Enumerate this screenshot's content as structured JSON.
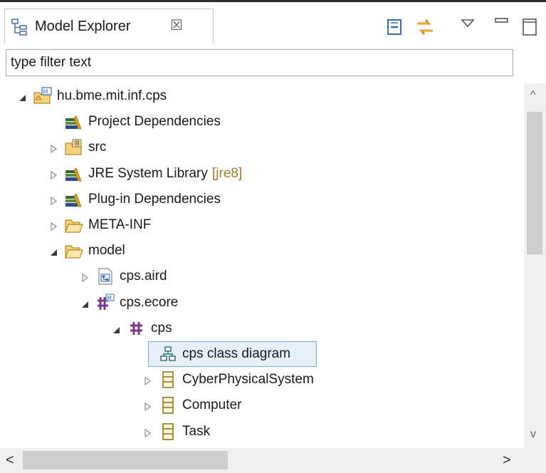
{
  "view": {
    "title": "Model Explorer",
    "close_glyph": "☒",
    "filter_placeholder": "type filter text",
    "toolbar": [
      {
        "name": "collapse-all-icon"
      },
      {
        "name": "link-with-editor-icon"
      },
      {
        "name": "view-menu-icon"
      },
      {
        "name": "minimize-icon"
      },
      {
        "name": "maximize-icon"
      }
    ]
  },
  "tree": [
    {
      "label": "hu.bme.mit.inf.cps",
      "decoration": "",
      "icon": "modeling-project-icon",
      "expanded": true,
      "has_children": true,
      "depth": 0
    },
    {
      "label": "Project Dependencies",
      "decoration": "",
      "icon": "library-icon",
      "expanded": false,
      "has_children": false,
      "depth": 1
    },
    {
      "label": "src",
      "decoration": "",
      "icon": "source-folder-icon",
      "expanded": false,
      "has_children": true,
      "depth": 1
    },
    {
      "label": "JRE System Library",
      "decoration": "[jre8]",
      "icon": "library-icon",
      "expanded": false,
      "has_children": true,
      "depth": 1
    },
    {
      "label": "Plug-in Dependencies",
      "decoration": "",
      "icon": "library-icon",
      "expanded": false,
      "has_children": true,
      "depth": 1
    },
    {
      "label": "META-INF",
      "decoration": "",
      "icon": "folder-icon",
      "expanded": false,
      "has_children": true,
      "depth": 1
    },
    {
      "label": "model",
      "decoration": "",
      "icon": "folder-icon",
      "expanded": true,
      "has_children": true,
      "depth": 1
    },
    {
      "label": "cps.aird",
      "decoration": "",
      "icon": "aird-file-icon",
      "expanded": false,
      "has_children": true,
      "depth": 2
    },
    {
      "label": "cps.ecore",
      "decoration": "",
      "icon": "ecore-file-icon",
      "expanded": true,
      "has_children": true,
      "depth": 2
    },
    {
      "label": "cps",
      "decoration": "",
      "icon": "epackage-icon",
      "expanded": true,
      "has_children": true,
      "depth": 3
    },
    {
      "label": "cps class diagram",
      "decoration": "",
      "icon": "class-diagram-icon",
      "expanded": false,
      "has_children": false,
      "depth": 4,
      "selected": true
    },
    {
      "label": "CyberPhysicalSystem",
      "decoration": "",
      "icon": "eclass-icon",
      "expanded": false,
      "has_children": true,
      "depth": 4
    },
    {
      "label": "Computer",
      "decoration": "",
      "icon": "eclass-icon",
      "expanded": false,
      "has_children": true,
      "depth": 4
    },
    {
      "label": "Task",
      "decoration": "",
      "icon": "eclass-icon",
      "expanded": false,
      "has_children": true,
      "depth": 4
    }
  ],
  "scroll": {
    "up_glyph": "^",
    "down_glyph": "v",
    "left_glyph": "<",
    "right_glyph": ">"
  }
}
